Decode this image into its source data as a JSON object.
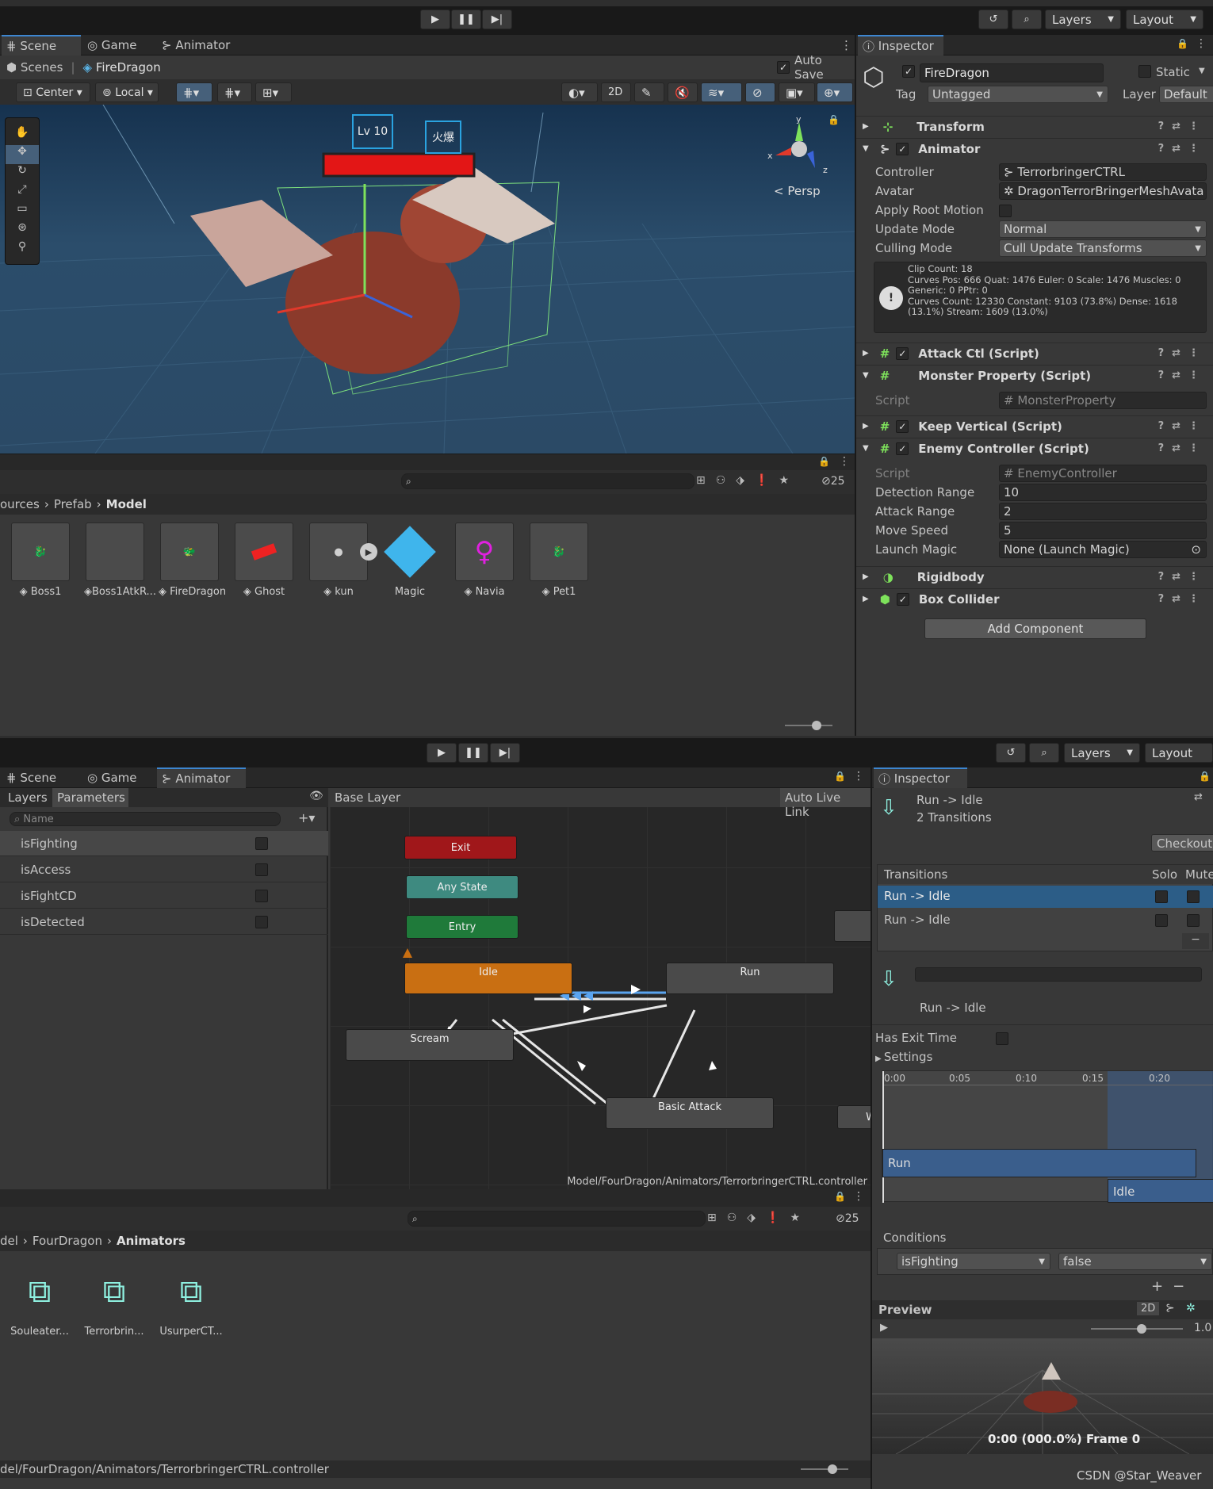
{
  "top": {
    "toolbar": {
      "layers": "Layers",
      "layout": "Layout"
    },
    "tabs": [
      "Scene",
      "Game",
      "Animator"
    ],
    "breadcrumb": {
      "scenes": "Scenes",
      "object": "FireDragon"
    },
    "auto_save": "Auto Save",
    "scene_tools": {
      "pivot": "Center",
      "space": "Local",
      "mode2d": "2D",
      "persp": "Persp"
    },
    "scene_overlay": {
      "lv": "Lv 10",
      "name": "火爆"
    },
    "project": {
      "path": [
        "ources",
        "Prefab",
        "Model"
      ],
      "count": "25",
      "assets": [
        "Boss1",
        "Boss1AtkR...",
        "FireDragon",
        "Ghost",
        "kun",
        "Magic",
        "Navia",
        "Pet1"
      ]
    }
  },
  "inspector": {
    "title": "Inspector",
    "name": "FireDragon",
    "static": "Static",
    "tag_label": "Tag",
    "tag": "Untagged",
    "layer_label": "Layer",
    "layer": "Default",
    "components": {
      "transform": "Transform",
      "animator": "Animator",
      "attack": "Attack Ctl (Script)",
      "monster": "Monster Property (Script)",
      "keep": "Keep Vertical (Script)",
      "enemy": "Enemy Controller (Script)",
      "rigidbody": "Rigidbody",
      "box": "Box Collider"
    },
    "animator_props": {
      "controller_label": "Controller",
      "controller": "TerrorbringerCTRL",
      "avatar_label": "Avatar",
      "avatar": "DragonTerrorBringerMeshAvata",
      "root_motion": "Apply Root Motion",
      "update_label": "Update Mode",
      "update": "Normal",
      "culling_label": "Culling Mode",
      "culling": "Cull Update Transforms",
      "info": [
        "Clip Count: 18",
        "Curves Pos: 666 Quat: 1476 Euler: 0 Scale: 1476 Muscles: 0",
        "Generic: 0 PPtr: 0",
        "Curves Count: 12330 Constant: 9103 (73.8%) Dense: 1618",
        "(13.1%) Stream: 1609 (13.0%)"
      ]
    },
    "script_label": "Script",
    "monster_script": "MonsterProperty",
    "enemy_script": "EnemyController",
    "enemy_props": {
      "det_label": "Detection Range",
      "det": "10",
      "atk_label": "Attack Range",
      "atk": "2",
      "spd_label": "Move Speed",
      "spd": "5",
      "magic_label": "Launch Magic",
      "magic": "None (Launch Magic)"
    },
    "add_component": "Add Component"
  },
  "bottom": {
    "toolbar": {
      "layers": "Layers",
      "layout": "Layout"
    },
    "tabs": [
      "Scene",
      "Game",
      "Animator"
    ],
    "sub_tabs": {
      "layers": "Layers",
      "params": "Parameters"
    },
    "search_placeholder": "Name",
    "params": [
      "isFighting",
      "isAccess",
      "isFightCD",
      "isDetected"
    ],
    "graph": {
      "base_layer": "Base Layer",
      "auto_live": "Auto Live Link",
      "states": {
        "exit": "Exit",
        "any": "Any State",
        "entry": "Entry",
        "idle": "Idle",
        "run": "Run",
        "scream": "Scream",
        "basic": "Basic Attack",
        "cut": "W"
      },
      "path": "Model/FourDragon/Animators/TerrorbringerCTRL.controller"
    },
    "project": {
      "path": [
        "del",
        "FourDragon",
        "Animators"
      ],
      "count": "25",
      "assets": [
        "Souleater...",
        "Terrorbrin...",
        "UsurperCT..."
      ],
      "status": "del/FourDragon/Animators/TerrorbringerCTRL.controller"
    }
  },
  "transition": {
    "title": "Inspector",
    "header": "Run -> Idle",
    "sub": "2 Transitions",
    "checkout": "Checkout",
    "list_head": "Transitions",
    "solo": "Solo",
    "mute": "Mute",
    "items": [
      "Run -> Idle",
      "Run -> Idle"
    ],
    "detail": "Run -> Idle",
    "exit_time": "Has Exit Time",
    "settings": "Settings",
    "ticks": [
      "0:00",
      "0:05",
      "0:10",
      "0:15",
      "0:20"
    ],
    "clip_run": "Run",
    "clip_idle": "Idle",
    "conditions": "Conditions",
    "cond_param": "isFighting",
    "cond_value": "false",
    "preview": "Preview",
    "preview_2d": "2D",
    "speed": "1.0",
    "frame": "0:00 (000.0%) Frame 0"
  },
  "watermark": "CSDN @Star_Weaver",
  "colors": {
    "accent": "#3d86d0",
    "idle": "#c96f12",
    "exit": "#a0171a",
    "any": "#3e8a80",
    "entry": "#1f7a3a",
    "selected": "#2c5d87"
  }
}
